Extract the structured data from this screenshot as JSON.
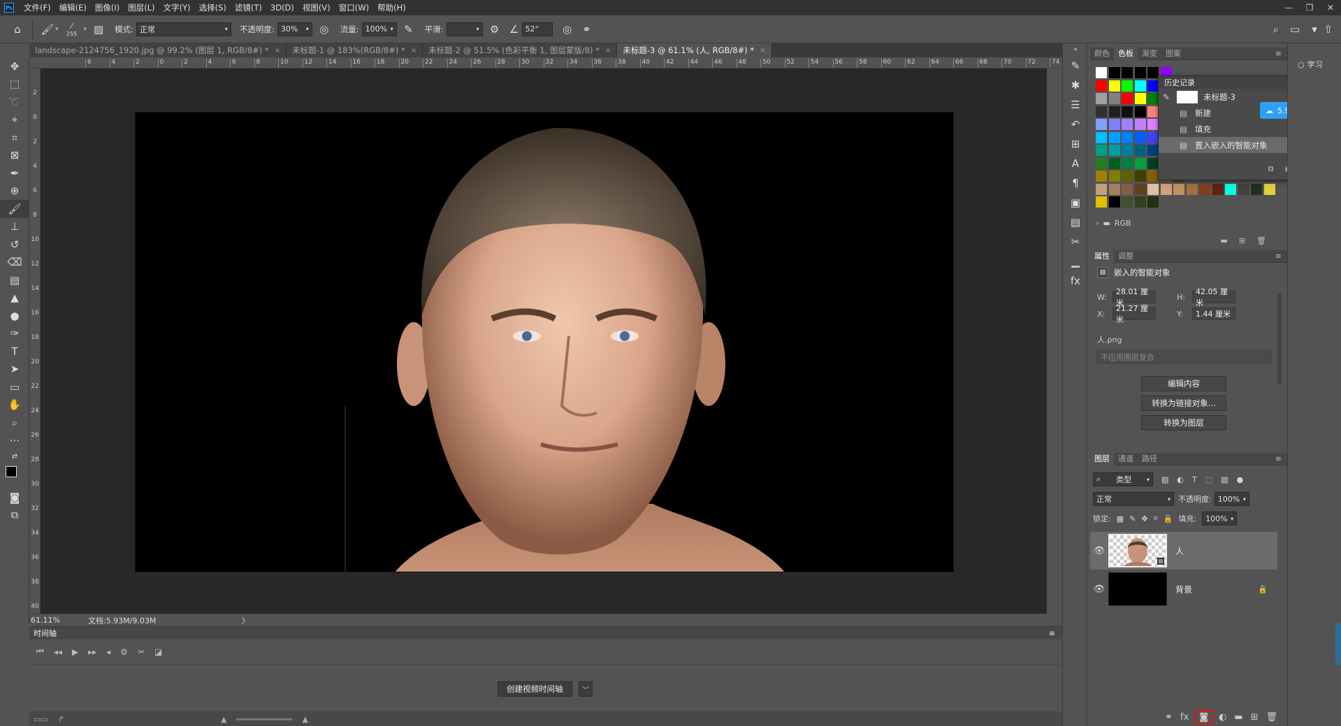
{
  "menubar": {
    "items": [
      "文件(F)",
      "编辑(E)",
      "图像(I)",
      "图层(L)",
      "文字(Y)",
      "选择(S)",
      "滤镜(T)",
      "3D(D)",
      "视图(V)",
      "窗口(W)",
      "帮助(H)"
    ],
    "logo": "Ps",
    "window_controls": [
      "—",
      "❐",
      "✕"
    ]
  },
  "options": {
    "brush_size": "255",
    "mode_label": "模式:",
    "mode_value": "正常",
    "opacity_label": "不透明度:",
    "opacity_value": "30%",
    "flow_label": "流量:",
    "flow_value": "100%",
    "smooth_label": "平滑:",
    "smooth_value": "",
    "angle_value": "52°"
  },
  "tabs": [
    {
      "label": "landscape-2124756_1920.jpg @ 99.2% (图层 1, RGB/8#) *",
      "close": "×"
    },
    {
      "label": "未标题-1 @ 183%(RGB/8#) *",
      "close": "×"
    },
    {
      "label": "未标题-2 @ 51.5% (色彩平衡 1, 图层蒙版/8) *",
      "close": "×"
    },
    {
      "label": "未标题-3 @ 61.1% (人, RGB/8#) *",
      "close": "×"
    }
  ],
  "ruler": {
    "h_labels": [
      "6",
      "4",
      "2",
      "0",
      "2",
      "4",
      "6",
      "8",
      "10",
      "12",
      "14",
      "16",
      "18",
      "20",
      "22",
      "24",
      "26",
      "28",
      "30",
      "32",
      "34",
      "36",
      "38",
      "40",
      "42",
      "44",
      "46",
      "48",
      "50",
      "52",
      "54",
      "56",
      "58",
      "60",
      "62",
      "64",
      "66",
      "68",
      "70",
      "72",
      "74"
    ],
    "v_labels": [
      "2",
      "0",
      "2",
      "4",
      "6",
      "8",
      "10",
      "12",
      "14",
      "16",
      "18",
      "20",
      "22",
      "24",
      "26",
      "28",
      "30",
      "32",
      "34",
      "36",
      "38",
      "40"
    ]
  },
  "status": {
    "zoom": "61.11%",
    "doc": "文档:5.93M/9.03M",
    "arrow": "〉"
  },
  "timeline": {
    "title": "时间轴",
    "create_button": "创建视频时间轴",
    "dropdown": "﹀"
  },
  "swatches_panel": {
    "tabs": [
      "颜色",
      "色板",
      "渐变",
      "图案"
    ],
    "active_tab": "色板",
    "group_label": "RGB"
  },
  "history": {
    "title": "历史记录",
    "snapshot": "未标题-3",
    "items": [
      "新建",
      "填充",
      "置入嵌入的智能对象"
    ]
  },
  "cloud": {
    "speed": "5.9 MB/s"
  },
  "learn": {
    "label": "学习"
  },
  "properties": {
    "tabs": [
      "属性",
      "调整"
    ],
    "type": "嵌入的智能对象",
    "w_label": "W:",
    "w_value": "28.01 厘米",
    "h_label": "H:",
    "h_value": "42.05 厘米",
    "x_label": "X:",
    "x_value": "21.27 厘米",
    "y_label": "Y:",
    "y_value": "1.44 厘米",
    "file": "人.png",
    "comp": "不应用图层复合",
    "buttons": [
      "编辑内容",
      "转换为链接对象...",
      "转换为图层"
    ]
  },
  "layers": {
    "tabs": [
      "图层",
      "通道",
      "路径"
    ],
    "filter_type": "类型",
    "blend_mode": "正常",
    "opacity_label": "不透明度:",
    "opacity_value": "100%",
    "lock_label": "锁定:",
    "fill_label": "填充:",
    "fill_value": "100%",
    "items": [
      {
        "name": "人"
      },
      {
        "name": "背景"
      }
    ]
  },
  "colors": {
    "menubar": "#323232",
    "panel": "#535353",
    "pasteboard": "#282828",
    "highlight": "#e41515",
    "cloud": "#2ea0f7"
  }
}
